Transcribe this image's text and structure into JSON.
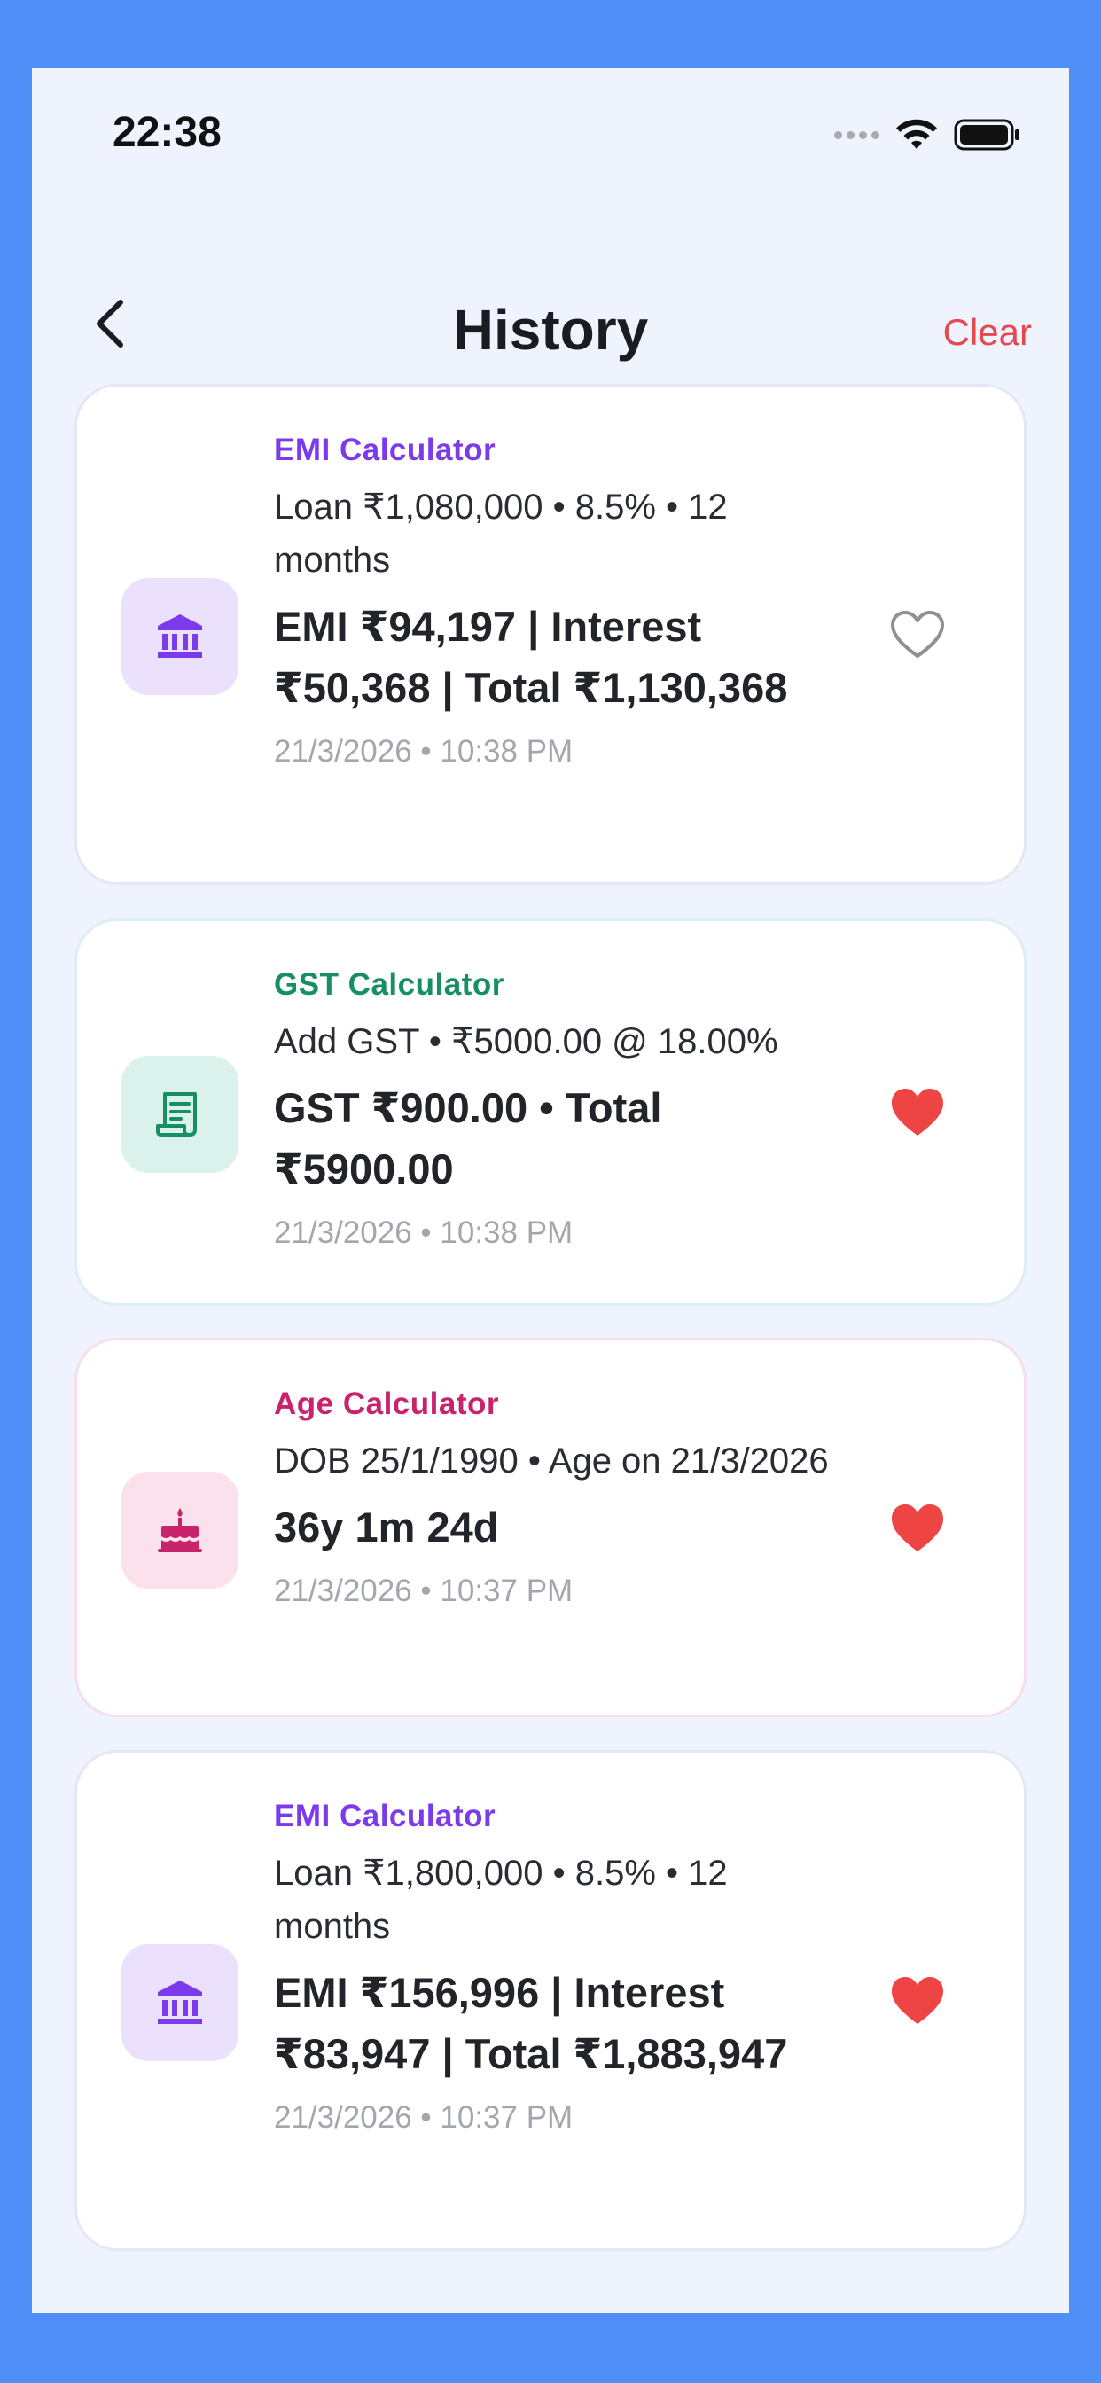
{
  "status_bar": {
    "time": "22:38"
  },
  "header": {
    "title": "History",
    "clear_label": "Clear"
  },
  "colors": {
    "emi": "#7c3aed",
    "gst": "#169063",
    "age": "#c8246c",
    "heart_active": "#ef4444",
    "clear": "#e5484d"
  },
  "items": [
    {
      "category": "EMI Calculator",
      "icon": "bank-icon",
      "details": "Loan ₹1,080,000 • 8.5% • 12 months",
      "result": "EMI ₹94,197 | Interest ₹50,368 | Total ₹1,130,368",
      "timestamp": "21/3/2026 • 10:38 PM",
      "favorite": false
    },
    {
      "category": "GST Calculator",
      "icon": "receipt-icon",
      "details": "Add GST • ₹5000.00 @ 18.00%",
      "result": "GST ₹900.00 • Total ₹5900.00",
      "timestamp": "21/3/2026 • 10:38 PM",
      "favorite": true
    },
    {
      "category": "Age Calculator",
      "icon": "cake-icon",
      "details": "DOB 25/1/1990 • Age on 21/3/2026",
      "result": "36y 1m 24d",
      "timestamp": "21/3/2026 • 10:37 PM",
      "favorite": true
    },
    {
      "category": "EMI Calculator",
      "icon": "bank-icon",
      "details": "Loan ₹1,800,000 • 8.5% • 12 months",
      "result": "EMI ₹156,996 | Interest ₹83,947 | Total ₹1,883,947",
      "timestamp": "21/3/2026 • 10:37 PM",
      "favorite": true
    }
  ]
}
